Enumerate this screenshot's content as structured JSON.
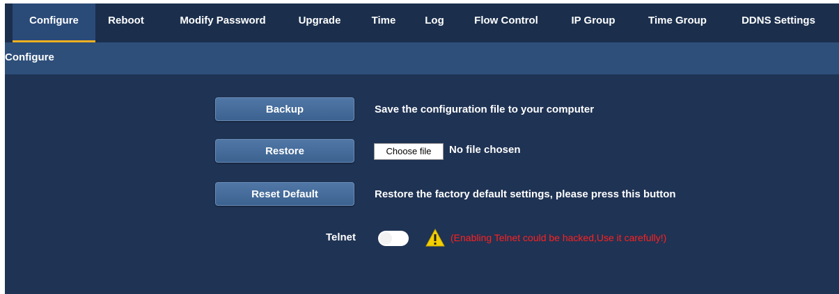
{
  "tabs": [
    {
      "label": "Configure",
      "active": true
    },
    {
      "label": "Reboot"
    },
    {
      "label": "Modify Password"
    },
    {
      "label": "Upgrade"
    },
    {
      "label": "Time"
    },
    {
      "label": "Log"
    },
    {
      "label": "Flow Control"
    },
    {
      "label": "IP Group"
    },
    {
      "label": "Time Group"
    },
    {
      "label": "DDNS Settings"
    }
  ],
  "breadcrumb": "Configure",
  "backup": {
    "button_label": "Backup",
    "description": "Save the configuration file to your computer"
  },
  "restore": {
    "button_label": "Restore",
    "choose_file_label": "Choose file",
    "file_status": "No file chosen"
  },
  "reset": {
    "button_label": "Reset Default",
    "description": "Restore the factory default settings, please press this button"
  },
  "telnet": {
    "label": "Telnet",
    "enabled": false,
    "warning_icon": "warning-icon",
    "warning_text": "(Enabling Telnet could be hacked,Use it carefully!)"
  },
  "colors": {
    "background": "#1f3354",
    "tabbar": "#1b2f4d",
    "active_tab_underline": "#f0b020",
    "warning_text": "#ff2020",
    "warning_icon": "#f5d000"
  }
}
